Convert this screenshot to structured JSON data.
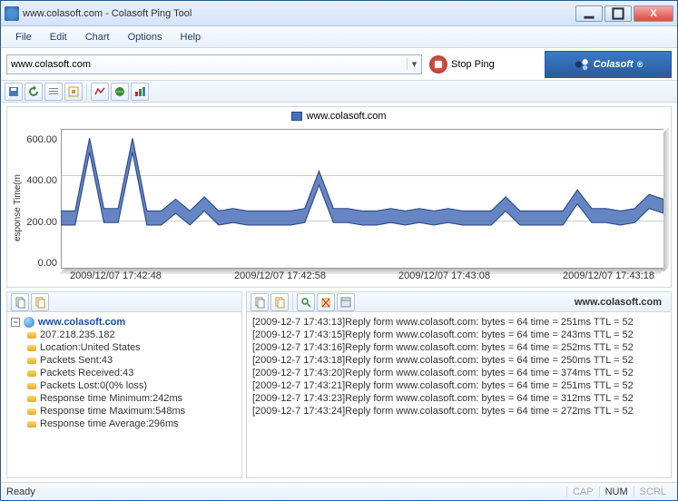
{
  "window": {
    "title": "www.colasoft.com - Colasoft Ping Tool"
  },
  "menu": {
    "file": "File",
    "edit": "Edit",
    "chart": "Chart",
    "options": "Options",
    "help": "Help"
  },
  "address": {
    "value": "www.colasoft.com",
    "stop_label": "Stop Ping",
    "brand": "Colasoft"
  },
  "chart_data": {
    "type": "line",
    "title": "",
    "ylabel": "esponse Time(m",
    "xlabel": "",
    "ylim": [
      0,
      600
    ],
    "yticks": [
      "600.00",
      "400.00",
      "200.00",
      "0.00"
    ],
    "xticks": [
      "2009/12/07 17:42:48",
      "2009/12/07 17:42:58",
      "2009/12/07 17:43:08",
      "2009/12/07 17:43:18"
    ],
    "legend": "www.colasoft.com",
    "series": [
      {
        "name": "www.colasoft.com",
        "values": [
          250,
          250,
          560,
          260,
          260,
          560,
          250,
          250,
          300,
          250,
          310,
          250,
          260,
          250,
          250,
          250,
          250,
          260,
          420,
          260,
          260,
          250,
          250,
          260,
          250,
          260,
          250,
          260,
          250,
          250,
          250,
          310,
          250,
          250,
          250,
          250,
          340,
          260,
          260,
          250,
          260,
          320,
          300
        ]
      }
    ]
  },
  "tree": {
    "root": "www.colasoft.com",
    "items": [
      "207.218.235.182",
      "Location:United States",
      "Packets Sent:43",
      "Packets Received:43",
      "Packets Lost:0(0% loss)",
      "Response time Minimum:242ms",
      "Response time Maximum:548ms",
      "Response time  Average:296ms"
    ]
  },
  "log": {
    "host_label": "www.colasoft.com",
    "lines": [
      "[2009-12-7 17:43:13]Reply form www.colasoft.com: bytes = 64 time = 251ms TTL = 52",
      "[2009-12-7 17:43:15]Reply form www.colasoft.com: bytes = 64 time = 243ms TTL = 52",
      "[2009-12-7 17:43:16]Reply form www.colasoft.com: bytes = 64 time = 252ms TTL = 52",
      "[2009-12-7 17:43:18]Reply form www.colasoft.com: bytes = 64 time = 250ms TTL = 52",
      "[2009-12-7 17:43:20]Reply form www.colasoft.com: bytes = 64 time = 374ms TTL = 52",
      "[2009-12-7 17:43:21]Reply form www.colasoft.com: bytes = 64 time = 251ms TTL = 52",
      "[2009-12-7 17:43:23]Reply form www.colasoft.com: bytes = 64 time = 312ms TTL = 52",
      "[2009-12-7 17:43:24]Reply form www.colasoft.com: bytes = 64 time = 272ms TTL = 52"
    ]
  },
  "status": {
    "ready": "Ready",
    "cap": "CAP",
    "num": "NUM",
    "scrl": "SCRL"
  }
}
